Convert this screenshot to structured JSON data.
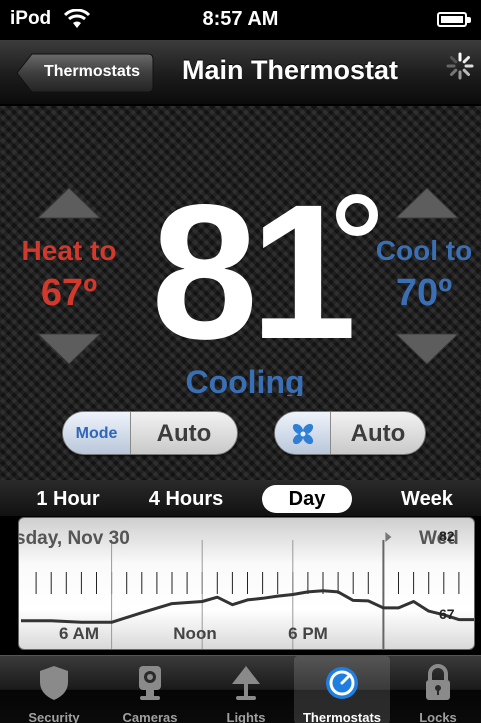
{
  "status_bar": {
    "carrier": "iPod",
    "time": "8:57 AM"
  },
  "nav": {
    "back_label": "Thermostats",
    "title": "Main Thermostat"
  },
  "thermostat": {
    "current_temp": "81",
    "heat_label": "Heat to",
    "heat_value": "67º",
    "cool_label": "Cool to",
    "cool_value": "70º",
    "status": "Cooling",
    "mode_label": "Mode",
    "mode_value": "Auto",
    "fan_value": "Auto",
    "colors": {
      "heat": "#d0392b",
      "cool": "#3a6fb4"
    }
  },
  "range_tabs": [
    {
      "label": "1 Hour",
      "selected": false
    },
    {
      "label": "4 Hours",
      "selected": false
    },
    {
      "label": "Day",
      "selected": true
    },
    {
      "label": "Week",
      "selected": false
    }
  ],
  "chart_data": {
    "type": "line",
    "title": "sday, Nov 30",
    "next_label": "Wed",
    "x_tick_labels": [
      "6 AM",
      "Noon",
      "6 PM"
    ],
    "x_hours": [
      0,
      2,
      4,
      6,
      8,
      10,
      12,
      13,
      14,
      15,
      16,
      17,
      18,
      19,
      20,
      21,
      22,
      23,
      24,
      25,
      26,
      27,
      28,
      29,
      30
    ],
    "y_values": [
      68.0,
      68.0,
      67.7,
      67.7,
      69.5,
      71.2,
      71.6,
      72.4,
      71.0,
      71.9,
      72.2,
      72.6,
      72.9,
      73.4,
      73.6,
      73.4,
      71.8,
      71.7,
      70.4,
      70.4,
      71.6,
      69.8,
      69.1,
      68.2,
      68.2
    ],
    "ylim": [
      67,
      82
    ],
    "ytick_labels": [
      "82",
      "67"
    ],
    "ylabel": "",
    "xlabel": ""
  },
  "tab_bar": [
    {
      "label": "Security",
      "icon": "shield-icon",
      "selected": false
    },
    {
      "label": "Cameras",
      "icon": "camera-icon",
      "selected": false
    },
    {
      "label": "Lights",
      "icon": "lamp-icon",
      "selected": false
    },
    {
      "label": "Thermostats",
      "icon": "thermostat-icon",
      "selected": true
    },
    {
      "label": "Locks",
      "icon": "lock-icon",
      "selected": false
    }
  ]
}
